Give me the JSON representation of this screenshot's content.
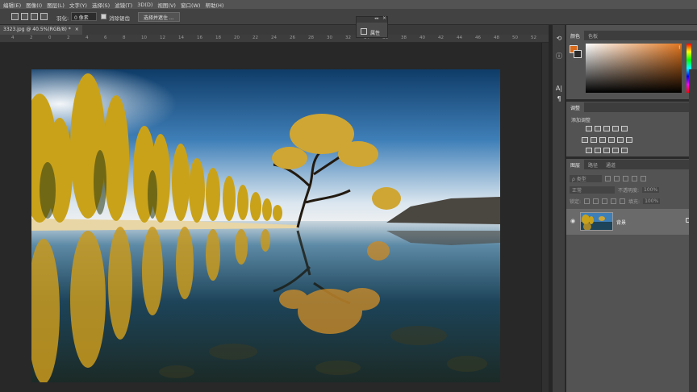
{
  "menubar": {
    "items": [
      "编辑(E)",
      "图像(I)",
      "图层(L)",
      "文字(Y)",
      "选择(S)",
      "滤镜(T)",
      "3D(D)",
      "视图(V)",
      "窗口(W)",
      "帮助(H)"
    ]
  },
  "options": {
    "feather_label": "羽化:",
    "feather_value": "0 像素",
    "antialias_label": "消除锯齿",
    "select_mask_button": "选择并遮住 ..."
  },
  "document": {
    "tab_title": "3323.jpg @ 40.5%(RGB/8) *",
    "close_glyph": "×"
  },
  "ruler": {
    "ticks": [
      "4",
      "2",
      "0",
      "2",
      "4",
      "6",
      "8",
      "10",
      "12",
      "14",
      "16",
      "18",
      "20",
      "22",
      "24",
      "26",
      "28",
      "30",
      "32",
      "34",
      "36",
      "38",
      "40",
      "42",
      "44",
      "46",
      "48",
      "50",
      "52"
    ]
  },
  "properties_panel": {
    "label": "属性",
    "collapse_glyph": "◂◂",
    "close_glyph": "×"
  },
  "color_panel": {
    "tabs": [
      "颜色",
      "色板"
    ],
    "foreground": "#d86a1a",
    "background": "#2a2a2a",
    "warning_glyph": "!"
  },
  "adjust_panel": {
    "tab": "调整",
    "add_label": "添加调整"
  },
  "layers_panel": {
    "tabs": [
      "图层",
      "路径",
      "通道"
    ],
    "filter_label": "ρ 类型",
    "blend_mode": "正常",
    "opacity_label": "不透明度:",
    "opacity_value": "100%",
    "lock_label": "锁定:",
    "fill_label": "填充:",
    "fill_value": "100%",
    "layer_name": "背景"
  },
  "toolstrip_icons": [
    "history-icon",
    "info-icon",
    "character-icon",
    "paragraph-icon"
  ],
  "toolstrip_glyphs": [
    "⟲",
    "ⓘ",
    "A|",
    "¶"
  ]
}
